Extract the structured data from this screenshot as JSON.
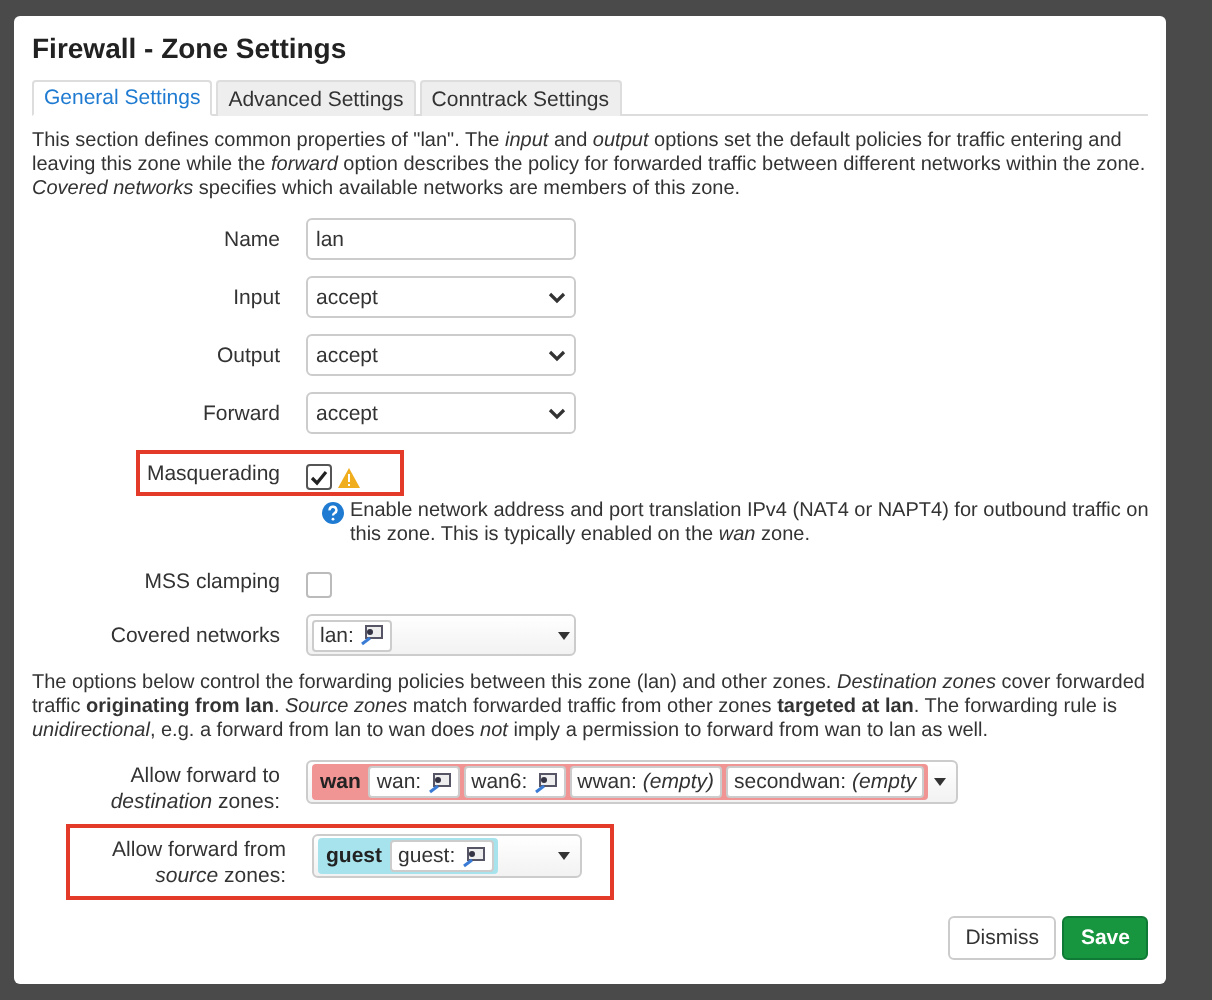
{
  "dialog": {
    "title": "Firewall - Zone Settings"
  },
  "tabs": [
    {
      "label": "General Settings",
      "selected": true
    },
    {
      "label": "Advanced Settings",
      "selected": false
    },
    {
      "label": "Conntrack Settings",
      "selected": false
    }
  ],
  "intro": "This section defines common properties of \"lan\". The *input* and *output* options set the default policies for traffic entering and leaving this zone while the *forward* option describes the policy for forwarded traffic between different networks within the zone. *Covered networks* specifies which available networks are members of this zone.",
  "fields": [
    {
      "kind": "text",
      "label": "Name",
      "value": "lan",
      "highlighted": false
    },
    {
      "kind": "select",
      "label": "Input",
      "value": "accept",
      "highlighted": false
    },
    {
      "kind": "select",
      "label": "Output",
      "value": "accept",
      "highlighted": false
    },
    {
      "kind": "select",
      "label": "Forward",
      "value": "accept",
      "highlighted": false
    },
    {
      "kind": "checkbox",
      "label": "Masquerading",
      "checked": true,
      "warning": true,
      "highlighted": true,
      "help": "Enable network address and port translation IPv4 (NAT4 or NAPT4) for outbound traffic on this zone. This is typically enabled on the *wan* zone."
    },
    {
      "kind": "checkbox",
      "label": "MSS clamping",
      "checked": false,
      "warning": false,
      "highlighted": false
    },
    {
      "kind": "networks",
      "label": "Covered networks",
      "highlighted": false,
      "networks": [
        {
          "name": "lan:",
          "kind": "device"
        }
      ]
    }
  ],
  "forwarding_intro": "The options below control the forwarding policies between this zone (lan) and other zones. *Destination zones* cover forwarded traffic **originating from lan**. *Source zones* match forwarded traffic from other zones **targeted at lan**. The forwarding rule is *unidirectional*, e.g. a forward from lan to wan does *not* imply a permission to forward from wan to lan as well.",
  "zone_fields": [
    {
      "label": "Allow forward to *destination* zones:",
      "highlighted": false,
      "zone": "wan",
      "color": "#f09494",
      "networks": [
        {
          "name": "wan:",
          "kind": "device"
        },
        {
          "name": "wan6:",
          "kind": "device"
        },
        {
          "name": "wwan:",
          "kind": "empty",
          "value": "(empty)"
        },
        {
          "name": "secondwan:",
          "kind": "empty",
          "value": "(empty"
        }
      ]
    },
    {
      "label": "Allow forward from *source* zones:",
      "highlighted": true,
      "zone": "guest",
      "color": "#a7e3ec",
      "networks": [
        {
          "name": "guest:",
          "kind": "device"
        }
      ]
    }
  ],
  "buttons": [
    {
      "label": "Dismiss",
      "kind": "secondary"
    },
    {
      "label": "Save",
      "kind": "primary"
    }
  ]
}
